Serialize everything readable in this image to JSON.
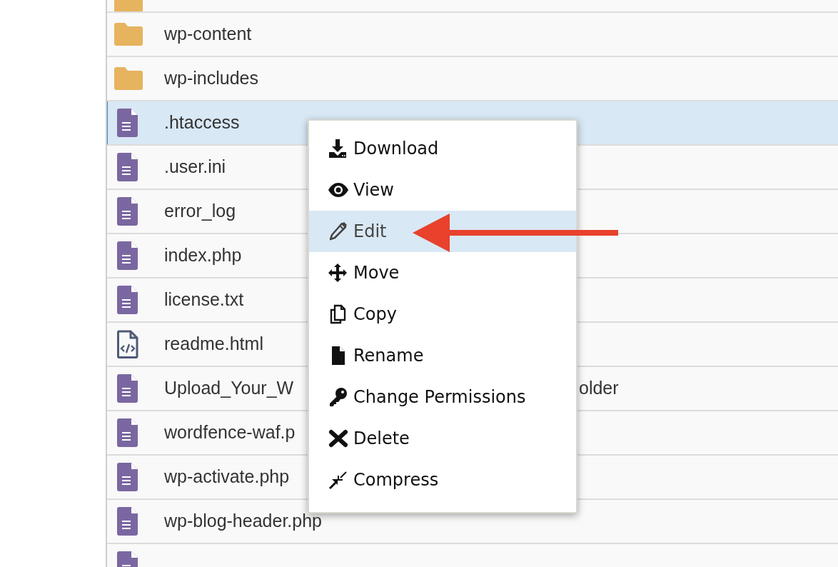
{
  "files": [
    {
      "kind": "folder",
      "selected": false
    },
    {
      "kind": "folder",
      "name": "wp-content",
      "selected": false
    },
    {
      "kind": "folder",
      "name": "wp-includes",
      "selected": false
    },
    {
      "kind": "file",
      "name": ".htaccess",
      "selected": true
    },
    {
      "kind": "file",
      "name": ".user.ini",
      "selected": false
    },
    {
      "kind": "file",
      "name": "error_log",
      "selected": false
    },
    {
      "kind": "file",
      "name": "index.php",
      "selected": false
    },
    {
      "kind": "file",
      "name": "license.txt",
      "selected": false
    },
    {
      "kind": "code",
      "name": "readme.html",
      "selected": false
    },
    {
      "kind": "file",
      "name": "Upload_Your_W",
      "tail": "older",
      "selected": false
    },
    {
      "kind": "file",
      "name": "wordfence-waf.p",
      "selected": false
    },
    {
      "kind": "file",
      "name": "wp-activate.php",
      "selected": false
    },
    {
      "kind": "file",
      "name": "wp-blog-header.php",
      "selected": false
    },
    {
      "kind": "file",
      "selected": false
    }
  ],
  "context_menu": [
    {
      "kind": "download",
      "label": "Download",
      "selected": false
    },
    {
      "kind": "view",
      "label": "View",
      "selected": false
    },
    {
      "kind": "edit",
      "label": "Edit",
      "selected": true
    },
    {
      "kind": "move",
      "label": "Move",
      "selected": false
    },
    {
      "kind": "copy",
      "label": "Copy",
      "selected": false
    },
    {
      "kind": "rename",
      "label": "Rename",
      "selected": false
    },
    {
      "kind": "permissions",
      "label": "Change Permissions",
      "selected": false
    },
    {
      "kind": "delete",
      "label": "Delete",
      "selected": false
    },
    {
      "kind": "compress",
      "label": "Compress",
      "selected": false
    }
  ]
}
